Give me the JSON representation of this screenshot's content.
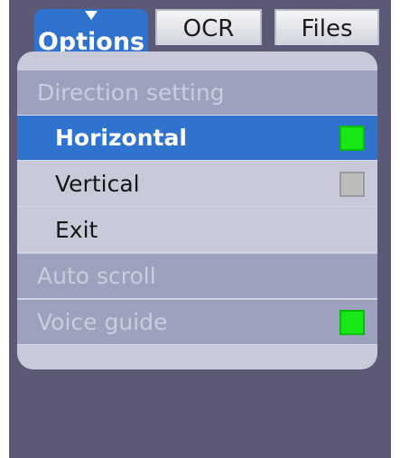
{
  "tabs": [
    {
      "label": "Options"
    },
    {
      "label": "OCR"
    },
    {
      "label": "Files"
    }
  ],
  "menu": {
    "direction_header": "Direction setting",
    "horizontal": {
      "label": "Horizontal",
      "checked": true
    },
    "vertical": {
      "label": "Vertical",
      "checked": false
    },
    "exit": {
      "label": "Exit"
    },
    "auto_scroll": {
      "label": "Auto scroll"
    },
    "voice_guide": {
      "label": "Voice guide",
      "checked": true
    }
  },
  "colors": {
    "accent": "#2f73cf",
    "check_on": "#16e816",
    "check_off": "#bcbcbc",
    "background": "#5b5975"
  }
}
